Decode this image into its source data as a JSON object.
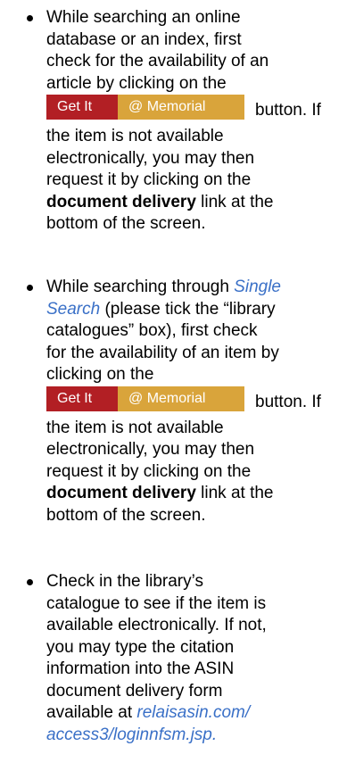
{
  "items": [
    {
      "lines_before": [
        "While searching an online",
        "database or an index, first",
        "check for the availability of an",
        "article by clicking on the"
      ],
      "button": {
        "left": "Get It",
        "right": "@ Memorial"
      },
      "after_button": "button. If",
      "lines_after": [
        "the item is not available",
        "electronically, you may then",
        "request it by clicking on the"
      ],
      "bold_line": {
        "bold": "document delivery",
        "rest": " link at the"
      },
      "last_line": "bottom of the screen."
    },
    {
      "line1_prefix": "While searching through ",
      "line1_link": "Single",
      "line2_link": "Search",
      "line2_rest": " (please tick the “library",
      "lines_before": [
        "catalogues” box), first check",
        "for the availability of an item by",
        "clicking on the"
      ],
      "button": {
        "left": "Get It",
        "right": "@ Memorial"
      },
      "after_button": "button. If",
      "lines_after": [
        "the item is not available",
        "electronically, you may then",
        "request it by clicking on the"
      ],
      "bold_line": {
        "bold": "document delivery",
        "rest": " link at the"
      },
      "last_line": "bottom of the screen."
    },
    {
      "lines": [
        "Check in the library’s",
        "catalogue to see if the item is",
        "available electronically. If not,",
        "you may type the citation",
        "information into the ASIN",
        "document delivery form"
      ],
      "last_prefix": "available at ",
      "link_line1": "relaisasin.com/",
      "link_line2": "access3/loginnfsm.jsp",
      "link_suffix": "."
    }
  ]
}
